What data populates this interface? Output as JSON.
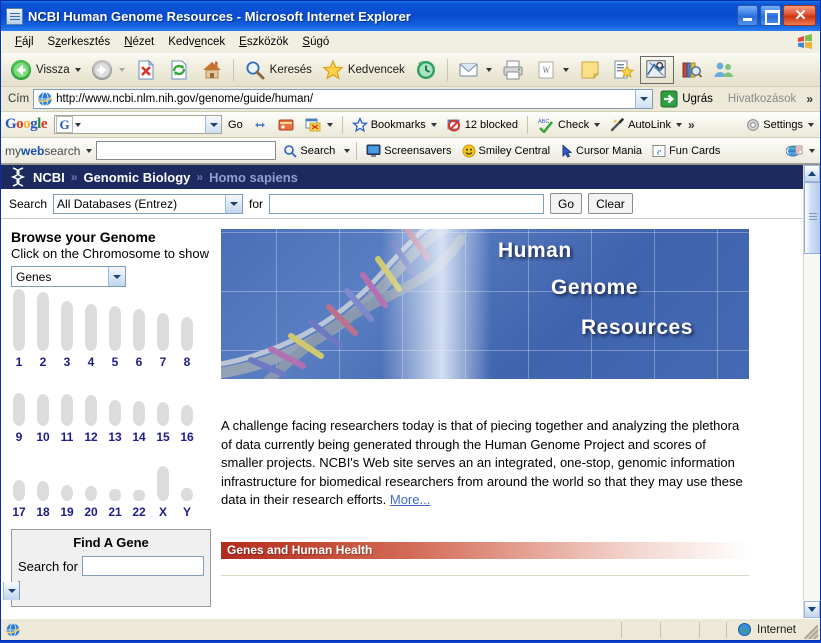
{
  "window": {
    "title": "NCBI Human Genome Resources - Microsoft Internet Explorer",
    "minimize_label": "Minimize",
    "maximize_label": "Maximize",
    "close_label": "Close"
  },
  "menu": {
    "items": [
      {
        "label": "Fájl",
        "accel": "F"
      },
      {
        "label": "Szerkesztés",
        "accel": "z"
      },
      {
        "label": "Nézet",
        "accel": "N"
      },
      {
        "label": "Kedvencek",
        "accel": "v"
      },
      {
        "label": "Eszközök",
        "accel": "E"
      },
      {
        "label": "Súgó",
        "accel": "S"
      }
    ]
  },
  "toolbar": {
    "back_label": "Vissza",
    "forward_label": "",
    "stop_label": "",
    "refresh_label": "",
    "home_label": "",
    "search_label": "Keresés",
    "favorites_label": "Kedvencek",
    "history_label": "",
    "mail_label": "",
    "print_label": "",
    "edit_label": "",
    "discuss_label": "",
    "messenger_label": ""
  },
  "address": {
    "label": "Cím",
    "url": "http://www.ncbi.nlm.nih.gov/genome/guide/human/",
    "go_label": "Ugrás",
    "links_label": "Hivatkozások",
    "overflow_label": "»"
  },
  "google_toolbar": {
    "logo": "Google",
    "search_value": "",
    "search_placeholder": "",
    "go_label": "Go",
    "bookmarks_label": "Bookmarks",
    "blocked_label": "12 blocked",
    "check_label": "Check",
    "autolink_label": "AutoLink",
    "overflow_label": "»",
    "settings_label": "Settings"
  },
  "mywebsearch_toolbar": {
    "logo_my": "my",
    "logo_web": "web",
    "logo_search": "search",
    "search_value": "",
    "search_button_label": "Search",
    "screensavers_label": "Screensavers",
    "smiley_label": "Smiley Central",
    "cursor_label": "Cursor Mania",
    "funcards_label": "Fun Cards"
  },
  "ncbi_header": {
    "brand": "NCBI",
    "separator": "»",
    "section": "Genomic Biology",
    "organism": "Homo sapiens",
    "bg_color": "#1c2a60"
  },
  "ncbi_search": {
    "label": "Search",
    "database_value": "All Databases (Entrez)",
    "for_label": "for",
    "query_value": "",
    "go_label": "Go",
    "clear_label": "Clear"
  },
  "sidebar": {
    "browse_title": "Browse your Genome",
    "browse_sub": "Click on the Chromosome to show",
    "show_select_value": "Genes",
    "chromosome_rows": [
      {
        "labels": [
          "1",
          "2",
          "3",
          "4",
          "5",
          "6",
          "7",
          "8"
        ],
        "heights": [
          62,
          59,
          50,
          47,
          45,
          42,
          38,
          34
        ]
      },
      {
        "labels": [
          "9",
          "10",
          "11",
          "12",
          "13",
          "14",
          "15",
          "16"
        ],
        "heights": [
          33,
          32,
          32,
          31,
          26,
          25,
          24,
          21
        ]
      },
      {
        "labels": [
          "17",
          "18",
          "19",
          "20",
          "21",
          "22",
          "X",
          "Y"
        ],
        "heights": [
          21,
          20,
          16,
          15,
          12,
          11,
          35,
          13
        ]
      }
    ],
    "chromosome_color": "#dcdcdc",
    "chromosome_label_color": "#1c1c8c",
    "find_gene": {
      "title": "Find A Gene",
      "search_label": "Search for",
      "search_value": "",
      "select_value": ""
    }
  },
  "banner": {
    "line1": "Human",
    "line2": "Genome",
    "line3": "Resources",
    "bg_color": "#4a6fb8"
  },
  "main": {
    "paragraph": "A challenge facing researchers today is that of piecing together and analyzing the plethora of data currently being generated through the Human Genome Project and scores of smaller projects. NCBI's Web site serves an an integrated, one-stop, genomic information infrastructure for biomedical researchers from around the world so that they may use these data in their research efforts.",
    "more_link": "More...",
    "section_heading": "Genes and Human Health",
    "section_color": "#b32b20"
  },
  "statusbar": {
    "message": "",
    "zone_label": "Internet"
  }
}
